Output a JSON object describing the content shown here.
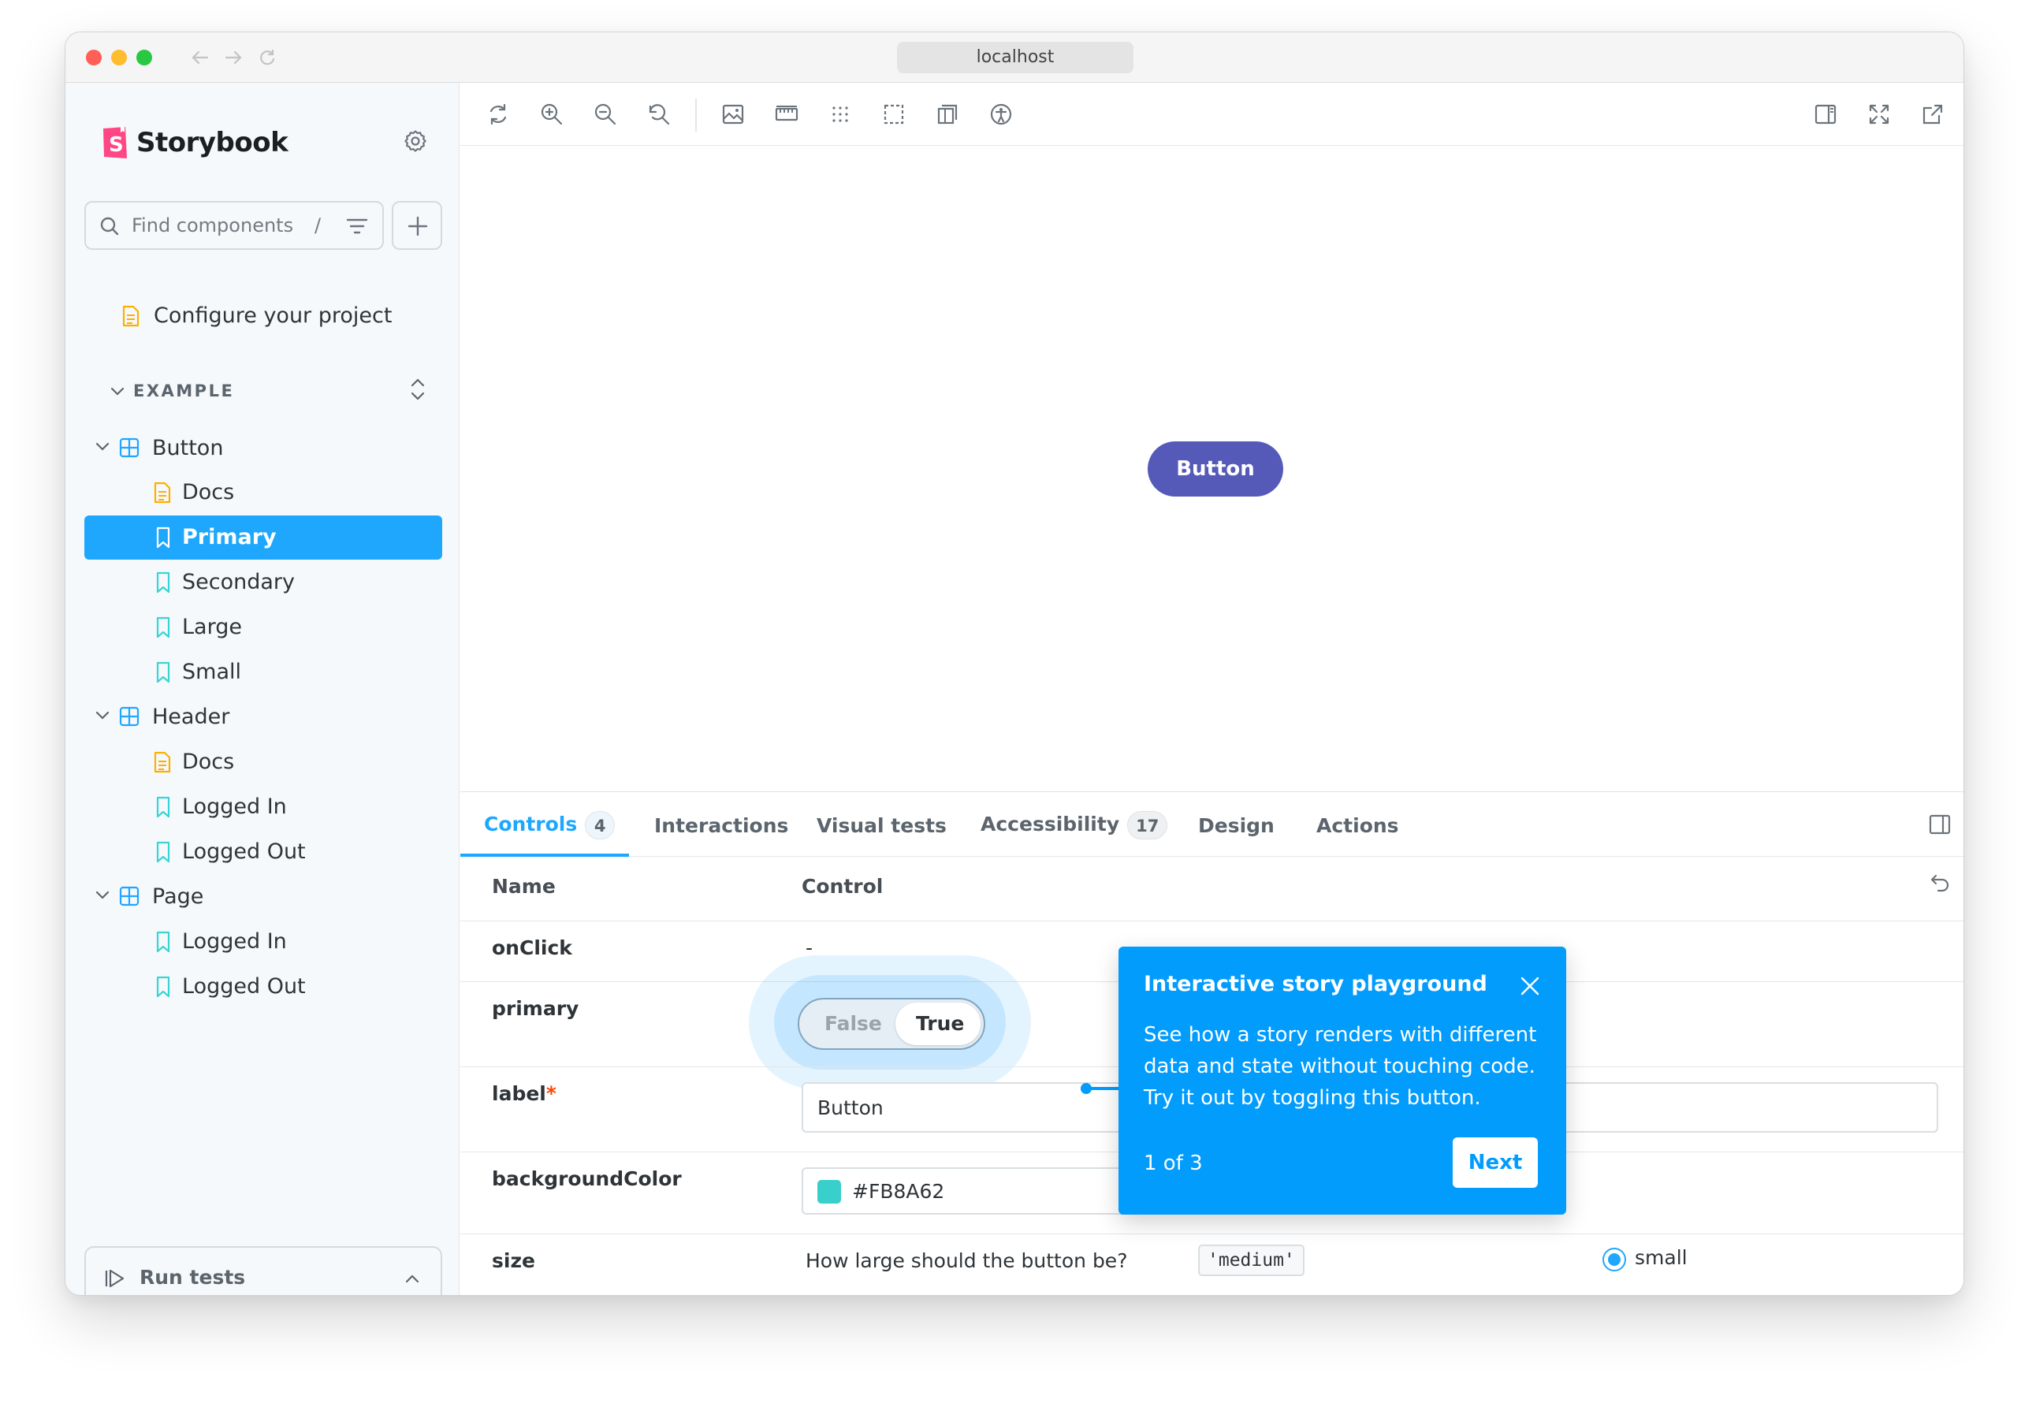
{
  "browser": {
    "url": "localhost"
  },
  "sidebar": {
    "brand": "Storybook",
    "search_placeholder": "Find components",
    "search_shortcut": "/",
    "configure": "Configure your project",
    "section": "EXAMPLE",
    "items": [
      {
        "label": "Button"
      },
      {
        "label": "Docs"
      },
      {
        "label": "Primary"
      },
      {
        "label": "Secondary"
      },
      {
        "label": "Large"
      },
      {
        "label": "Small"
      },
      {
        "label": "Header"
      },
      {
        "label": "Docs"
      },
      {
        "label": "Logged In"
      },
      {
        "label": "Logged Out"
      },
      {
        "label": "Page"
      },
      {
        "label": "Logged In"
      },
      {
        "label": "Logged Out"
      }
    ],
    "run_tests": "Run tests"
  },
  "canvas": {
    "button_label": "Button",
    "button_color": "#555ab9"
  },
  "addons": {
    "tabs": [
      {
        "label": "Controls",
        "badge": "4"
      },
      {
        "label": "Interactions"
      },
      {
        "label": "Visual tests"
      },
      {
        "label": "Accessibility",
        "badge": "17"
      },
      {
        "label": "Design"
      },
      {
        "label": "Actions"
      }
    ],
    "columns": {
      "name": "Name",
      "control": "Control"
    },
    "rows": {
      "onclick": {
        "name": "onClick",
        "value": "-"
      },
      "primary": {
        "name": "primary",
        "off": "False",
        "on": "True"
      },
      "label": {
        "name": "label",
        "required": "*",
        "value": "Button"
      },
      "background": {
        "name": "backgroundColor",
        "value": "#FB8A62",
        "swatch": "#39d0cc"
      },
      "size": {
        "name": "size",
        "description": "How large should the button be?",
        "default": "'medium'",
        "option": "small"
      }
    }
  },
  "tour": {
    "title": "Interactive story playground",
    "body": "See how a story renders with different data and state without touching code. Try it out by toggling this button.",
    "step": "1 of 3",
    "next": "Next"
  },
  "colors": {
    "accent": "#1ea7fd",
    "tooltip": "#029cfd",
    "brand": "#ff4785"
  }
}
